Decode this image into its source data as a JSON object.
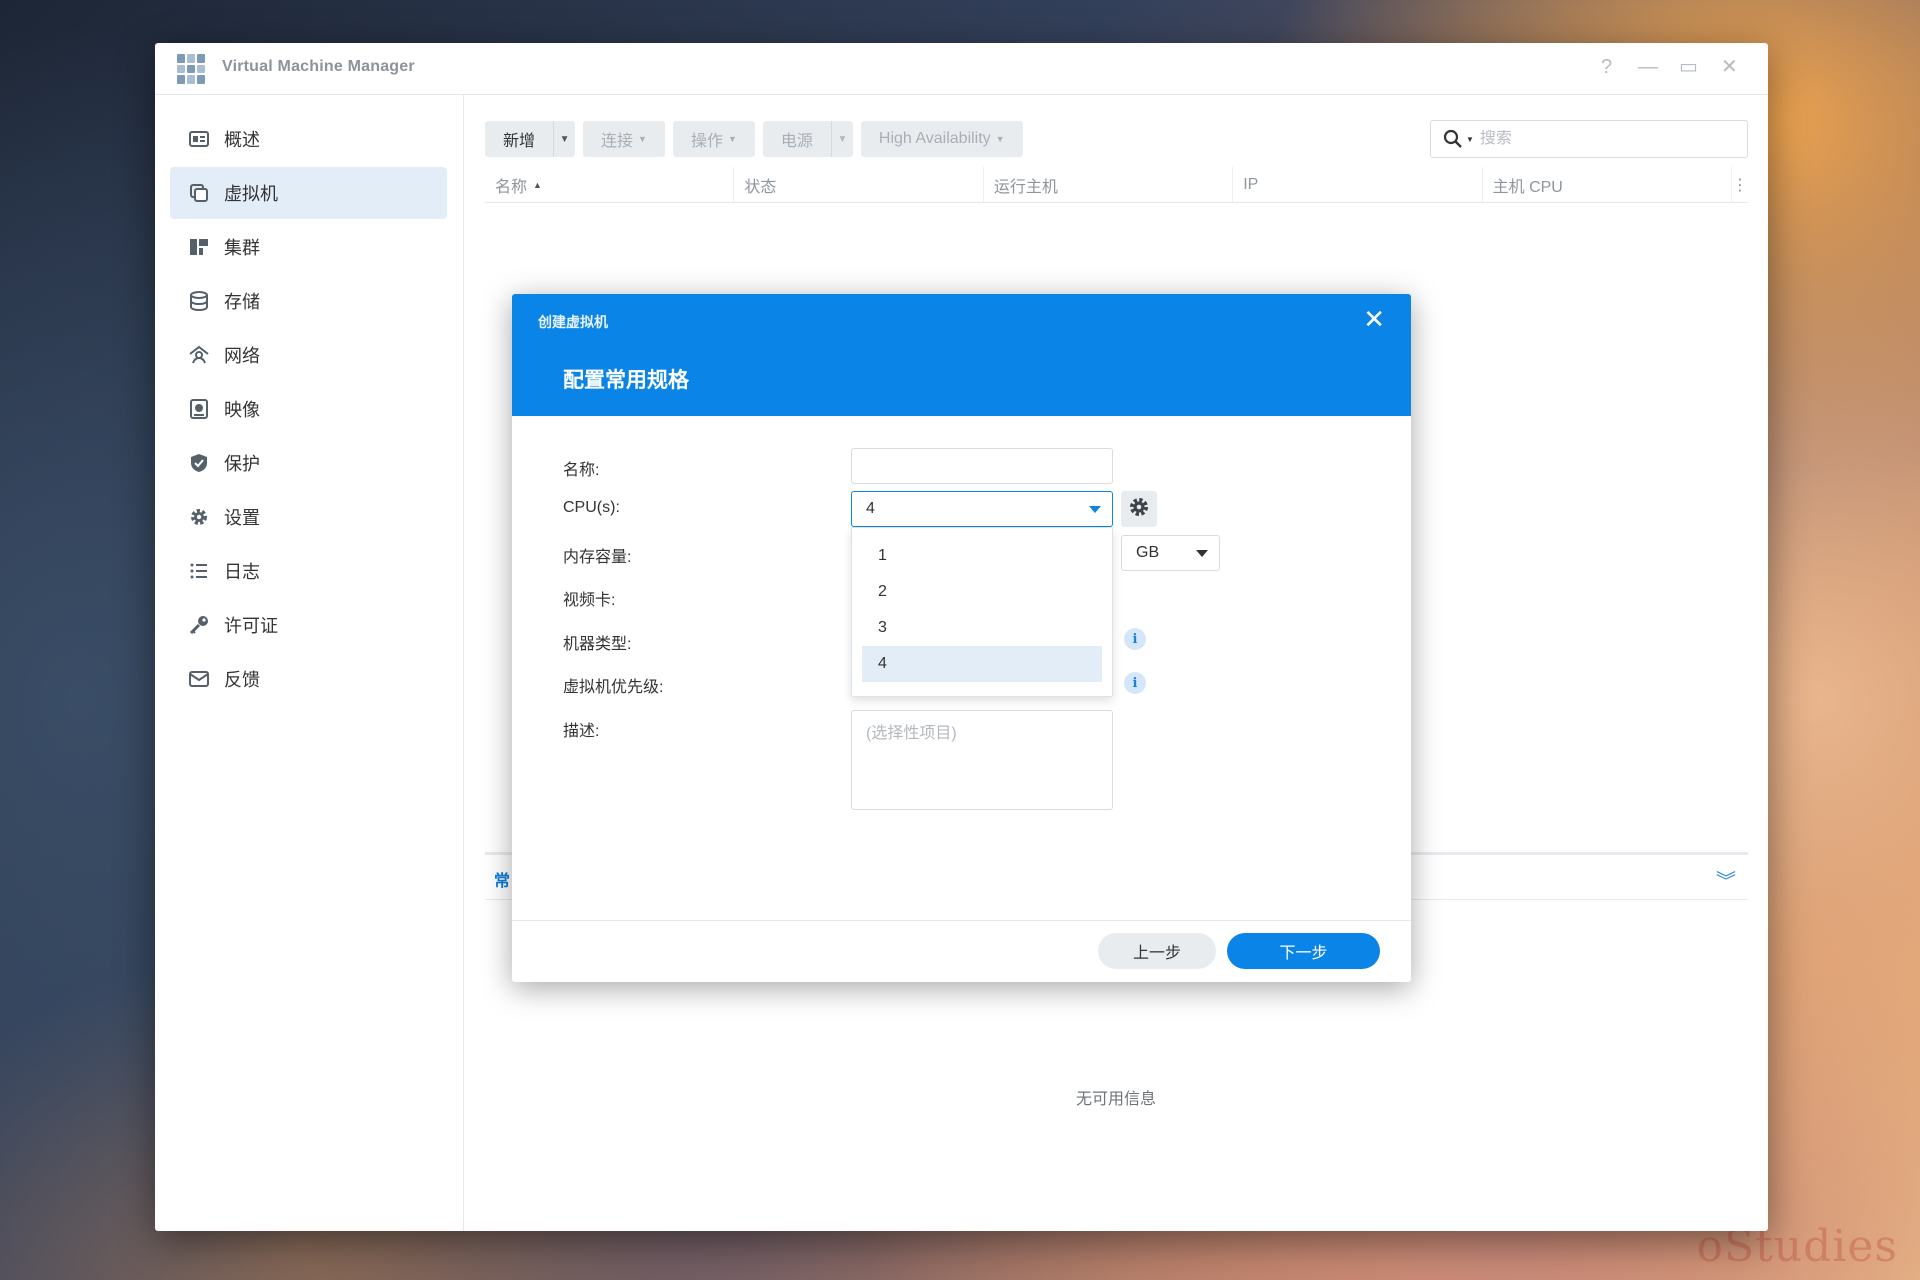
{
  "window": {
    "title": "Virtual Machine Manager",
    "controls": {
      "help": "?",
      "minimize": "—",
      "maximize": "▭",
      "close": "✕"
    }
  },
  "sidebar": {
    "items": [
      {
        "label": "概述",
        "icon": "overview-icon"
      },
      {
        "label": "虚拟机",
        "icon": "virtual-machine-icon",
        "active": true
      },
      {
        "label": "集群",
        "icon": "cluster-icon"
      },
      {
        "label": "存储",
        "icon": "storage-icon"
      },
      {
        "label": "网络",
        "icon": "network-icon"
      },
      {
        "label": "映像",
        "icon": "image-icon"
      },
      {
        "label": "保护",
        "icon": "shield-icon"
      },
      {
        "label": "设置",
        "icon": "gear-icon"
      },
      {
        "label": "日志",
        "icon": "list-icon"
      },
      {
        "label": "许可证",
        "icon": "key-icon"
      },
      {
        "label": "反馈",
        "icon": "mail-icon"
      }
    ]
  },
  "toolbar": {
    "create": "新增",
    "connect": "连接",
    "action": "操作",
    "power": "电源",
    "high_availability": "High Availability"
  },
  "search": {
    "placeholder": "搜索"
  },
  "table": {
    "columns": [
      "名称",
      "状态",
      "运行主机",
      "IP",
      "主机 CPU"
    ]
  },
  "detail": {
    "tab_label": "常"
  },
  "empty_message": "无可用信息",
  "dialog": {
    "small_title": "创建虚拟机",
    "title": "配置常用规格",
    "fields": {
      "name_label": "名称:",
      "name_value": "",
      "cpu_label": "CPU(s):",
      "cpu_value": "4",
      "memory_label": "内存容量:",
      "memory_unit": "GB",
      "video_label": "视频卡:",
      "machine_type_label": "机器类型:",
      "priority_label": "虚拟机优先级:",
      "description_label": "描述:",
      "description_placeholder": "(选择性项目)"
    },
    "cpu_options": [
      "1",
      "2",
      "3",
      "4"
    ],
    "cpu_selected": "4",
    "buttons": {
      "prev": "上一步",
      "next": "下一步"
    }
  },
  "colors": {
    "accent": "#0a84e6",
    "sidebar_active": "#e3edf8",
    "button_gray": "#e9ecef"
  }
}
